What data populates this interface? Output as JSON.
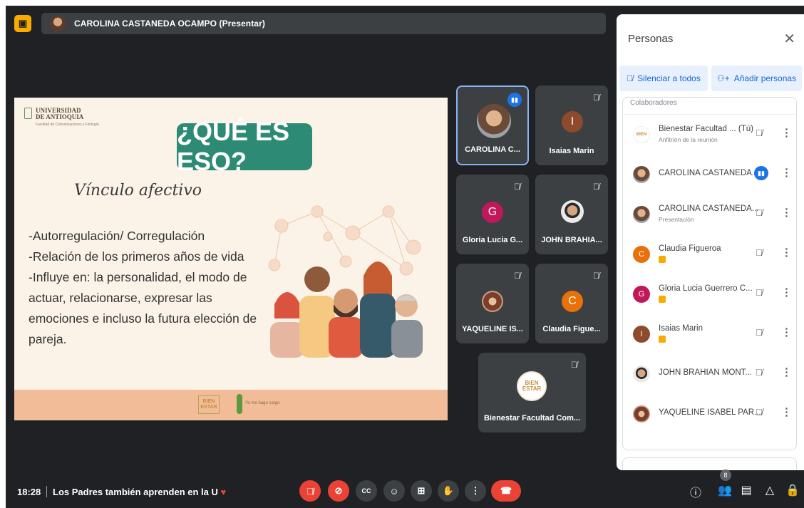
{
  "presenter_bar": {
    "text": "CAROLINA CASTANEDA OCAMPO (Presentar)",
    "present_icon": "presentation-icon"
  },
  "slide": {
    "university_line1": "UNIVERSIDAD",
    "university_line2": "DE ANTIOQUIA",
    "university_sub": "Facultad de Comunicaciones y Filología",
    "title": "¿QUÉ ES ESO?",
    "subtitle": "Vínculo afectivo",
    "bullets": [
      "-Autorregulación/ Corregulación",
      "-Relación de los primeros años de vida",
      "-Influye en: la personalidad, el modo de",
      "actuar, relacionarse, expresar las",
      "emociones e incluso la futura elección de",
      "pareja."
    ],
    "footer_logo1": "BIEN ESTAR",
    "footer_logo2": "Yo me hago cargo"
  },
  "tiles": [
    {
      "name": "CAROLINA C...",
      "initial": "",
      "speaking": true,
      "color": "#ffffff"
    },
    {
      "name": "Isaias Marin",
      "initial": "I",
      "speaking": false,
      "color": "#8d4a2c"
    },
    {
      "name": "Gloria Lucia G...",
      "initial": "G",
      "speaking": false,
      "color": "#c2185b"
    },
    {
      "name": "JOHN BRAHIA...",
      "initial": "",
      "speaking": false,
      "color": "#ffffff"
    },
    {
      "name": "YAQUELINE IS...",
      "initial": "",
      "speaking": false,
      "color": "#ffffff"
    },
    {
      "name": "Claudia Figue...",
      "initial": "C",
      "speaking": false,
      "color": "#e8710a"
    },
    {
      "name": "Bienestar Facultad Com...",
      "initial": "",
      "speaking": false,
      "color": "#ffffff"
    }
  ],
  "people_panel": {
    "title": "Personas",
    "mute_all_label": "Silenciar a todos",
    "add_people_label": "Añadir personas",
    "section_header": "Colaboradores",
    "participants": [
      {
        "name": "Bienestar Facultad ...",
        "suffix": "(Tú)",
        "sub": "Anfitrión de la reunión",
        "initial": "",
        "badge": false,
        "speaking": false,
        "color": "#ffffff"
      },
      {
        "name": "CAROLINA CASTANEDA...",
        "suffix": "",
        "sub": "",
        "initial": "",
        "badge": false,
        "speaking": true,
        "color": "#c9a27e"
      },
      {
        "name": "CAROLINA CASTANEDA...",
        "suffix": "",
        "sub": "Presentación",
        "initial": "",
        "badge": false,
        "speaking": false,
        "color": "#c9a27e"
      },
      {
        "name": "Claudia Figueroa",
        "suffix": "",
        "sub": "",
        "initial": "C",
        "badge": true,
        "speaking": false,
        "color": "#e8710a"
      },
      {
        "name": "Gloria Lucia Guerrero C...",
        "suffix": "",
        "sub": "",
        "initial": "G",
        "badge": true,
        "speaking": false,
        "color": "#c2185b"
      },
      {
        "name": "Isaias Marin",
        "suffix": "",
        "sub": "",
        "initial": "I",
        "badge": true,
        "speaking": false,
        "color": "#8d4a2c"
      },
      {
        "name": "JOHN BRAHIAN MONT...",
        "suffix": "",
        "sub": "",
        "initial": "",
        "badge": false,
        "speaking": false,
        "color": "#d5a681"
      },
      {
        "name": "YAQUELINE ISABEL PAR...",
        "suffix": "",
        "sub": "",
        "initial": "",
        "badge": false,
        "speaking": false,
        "color": "#7a3e2a"
      }
    ]
  },
  "bottom_bar": {
    "time": "18:28",
    "meeting_name": "Los Padres también aprenden en la U",
    "participant_count": "8"
  },
  "colors": {
    "accent_blue": "#1a73e8",
    "danger_red": "#ea4335",
    "slide_title_bg": "#2d8a74",
    "background": "#202124"
  }
}
